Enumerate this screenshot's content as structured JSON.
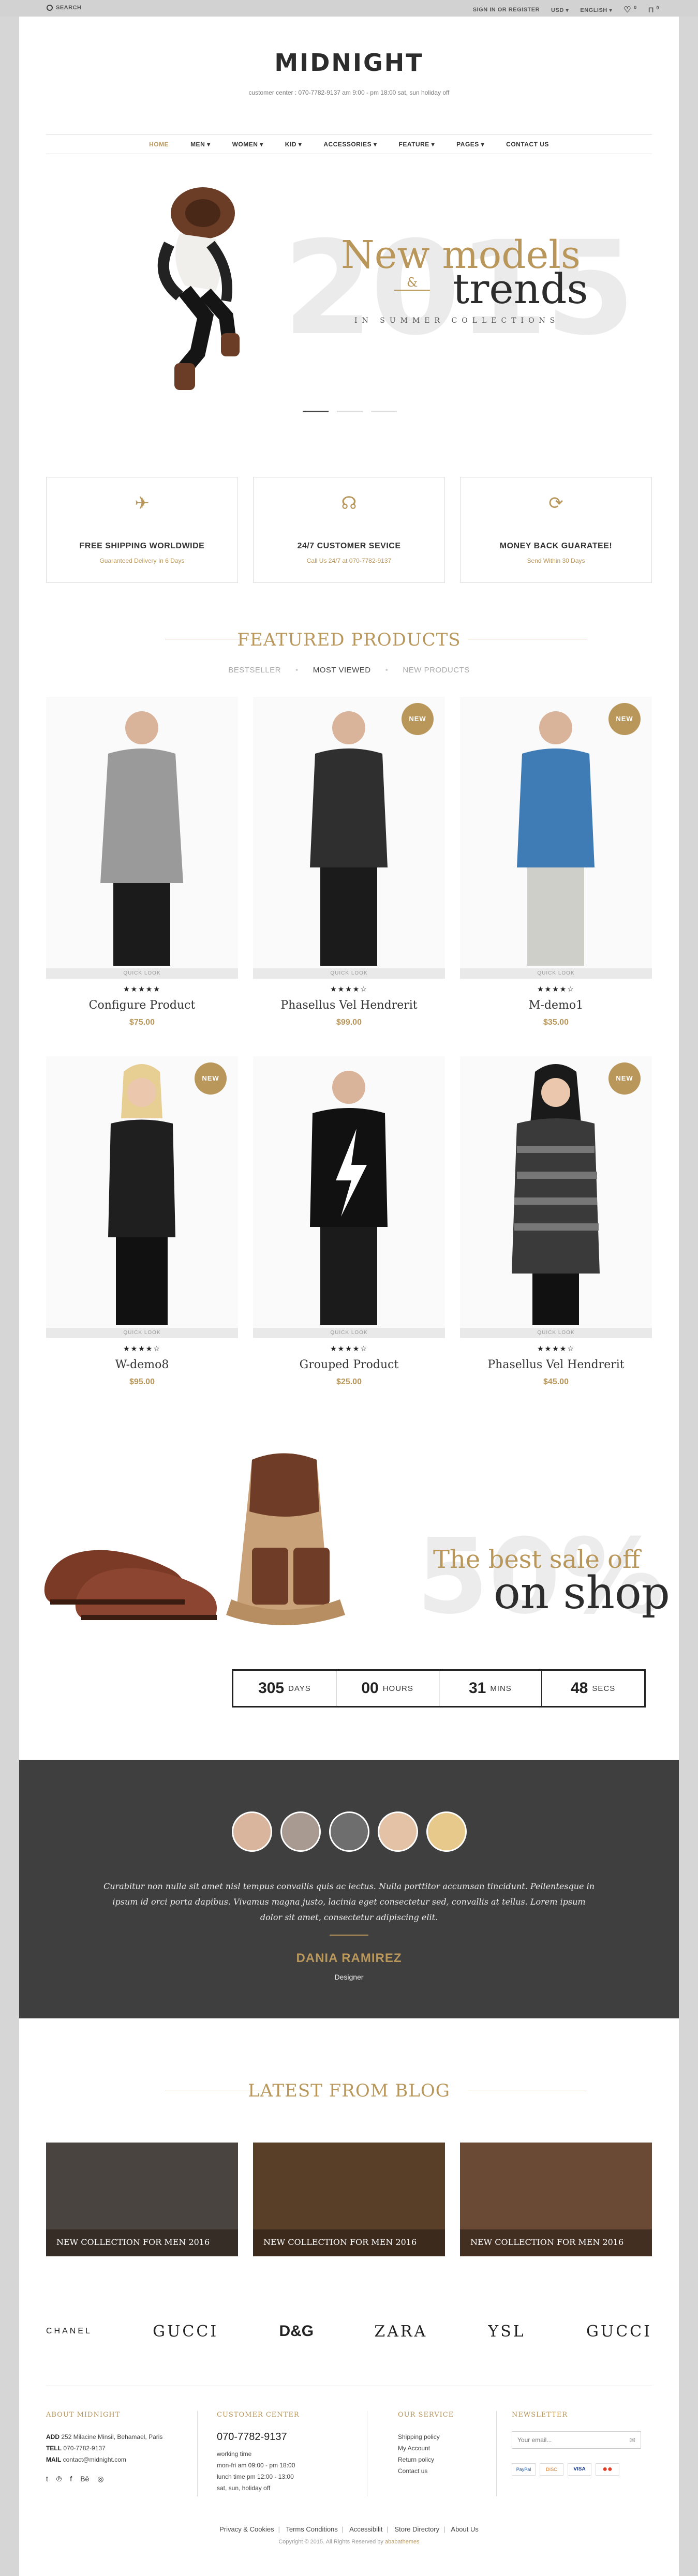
{
  "topbar": {
    "search_label": "SEARCH",
    "signin": "SIGN IN OR REGISTER",
    "currency": "USD",
    "language": "ENGLISH",
    "wishlist_count": "0",
    "cart_count": "0"
  },
  "header": {
    "logo": "MIDNIGHT",
    "tagline": "customer center : 070-7782-9137 am 9:00 - pm 18:00 sat, sun holiday off"
  },
  "nav": [
    "HOME",
    "MEN",
    "WOMEN",
    "KID",
    "ACCESSORIES",
    "FEATURE",
    "PAGES",
    "CONTACT US"
  ],
  "hero": {
    "bg_year": "2015",
    "line1": "New models",
    "amp": "&",
    "line2": "trends",
    "sub": "IN SUMMER COLLECTIONS"
  },
  "features": [
    {
      "icon": "plane-icon",
      "title": "FREE SHIPPING WORLDWIDE",
      "sub": "Guaranteed Delivery In 6 Days"
    },
    {
      "icon": "headphones-icon",
      "title": "24/7 CUSTOMER SEVICE",
      "sub": "Call Us 24/7 at 070-7782-9137"
    },
    {
      "icon": "refresh-icon",
      "title": "MONEY BACK GUARATEE!",
      "sub": "Send Within 30 Days"
    }
  ],
  "featured": {
    "title": "FEATURED PRODUCTS",
    "tabs": [
      "BESTSELLER",
      "MOST VIEWED",
      "NEW PRODUCTS"
    ],
    "quick_look": "QUICK LOOK",
    "badge": "NEW",
    "products": [
      {
        "name": "Configure Product",
        "price": "$75.00",
        "stars": "★★★★★",
        "new": false
      },
      {
        "name": "Phasellus Vel Hendrerit",
        "price": "$99.00",
        "stars": "★★★★☆",
        "new": true
      },
      {
        "name": "M-demo1",
        "price": "$35.00",
        "stars": "★★★★☆",
        "new": true
      },
      {
        "name": "W-demo8",
        "price": "$95.00",
        "stars": "★★★★☆",
        "new": true
      },
      {
        "name": "Grouped Product",
        "price": "$25.00",
        "stars": "★★★★☆",
        "new": false
      },
      {
        "name": "Phasellus Vel Hendrerit",
        "price": "$45.00",
        "stars": "★★★★☆",
        "new": true
      }
    ]
  },
  "sale": {
    "bg_text": "50%",
    "line1": "The best sale off",
    "line2": "on shop",
    "countdown": [
      {
        "value": "305",
        "unit": "DAYS"
      },
      {
        "value": "00",
        "unit": "HOURS"
      },
      {
        "value": "31",
        "unit": "MINS"
      },
      {
        "value": "48",
        "unit": "SECS"
      }
    ]
  },
  "testimonial": {
    "quote": "Curabitur non nulla sit amet nisl tempus convallis quis ac lectus. Nulla porttitor accumsan tincidunt. Pellentesque in ipsum id orci porta dapibus. Vivamus magna justo, lacinia eget consectetur sed, convallis at tellus. Lorem ipsum dolor sit amet, consectetur adipiscing elit.",
    "name": "DANIA RAMIREZ",
    "role": "Designer"
  },
  "blog": {
    "title": "LATEST FROM BLOG",
    "posts": [
      "NEW COLLECTION FOR MEN 2016",
      "NEW COLLECTION FOR MEN 2016",
      "NEW COLLECTION FOR MEN 2016"
    ]
  },
  "brands": [
    "CHANEL",
    "GUCCI",
    "D&G",
    "ZARA",
    "YSL",
    "GUCCI"
  ],
  "footer": {
    "about": {
      "title": "ABOUT MIDNIGHT",
      "add_label": "ADD",
      "add": "252 Milacine Minsil, Behamael, Paris",
      "tell_label": "TELL",
      "tell": "070-7782-9137",
      "mail_label": "MAIL",
      "mail": "contact@midnight.com"
    },
    "customer": {
      "title": "CUSTOMER CENTER",
      "phone": "070-7782-9137",
      "l1": "working time",
      "l2": "mon-fri am 09:00 - pm 18:00",
      "l3": "lunch time pm 12:00 - 13:00",
      "l4": "sat, sun, holiday off"
    },
    "service": {
      "title": "OUR SERVICE",
      "items": [
        "Shipping policy",
        "My Account",
        "Return policy",
        "Contact us"
      ]
    },
    "newsletter": {
      "title": "NEWSLETTER",
      "placeholder": "Your email..."
    },
    "links": [
      "Privacy & Cookies",
      "Terms Conditions",
      "Accessibilit",
      "Store Directory",
      "About Us"
    ],
    "copyright": "Copyright © 2015. All Rights Reserved by",
    "copyright_brand": "ababathemes"
  },
  "colors": {
    "accent": "#b9975b",
    "dark": "#2c2c2c",
    "testimonial_bg": "#3f3f3f"
  }
}
